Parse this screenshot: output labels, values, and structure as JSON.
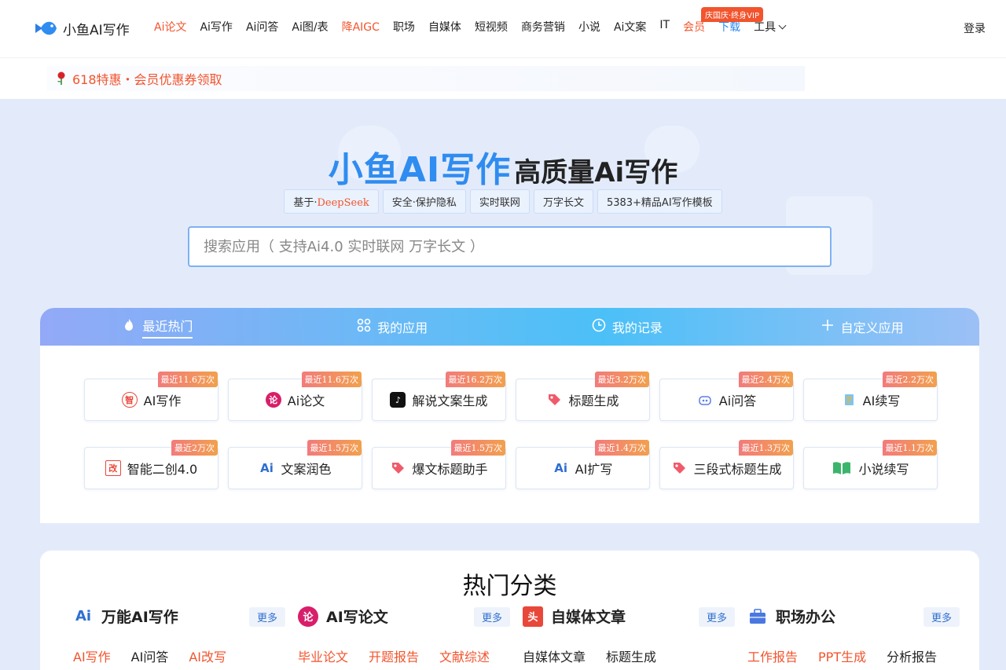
{
  "header": {
    "logo_text": "小鱼AI写作",
    "nav": [
      {
        "label": "Ai论文",
        "style": "red"
      },
      {
        "label": "Ai写作",
        "style": ""
      },
      {
        "label": "Ai问答",
        "style": ""
      },
      {
        "label": "Ai图/表",
        "style": ""
      },
      {
        "label": "降AIGC",
        "style": "red"
      },
      {
        "label": "职场",
        "style": ""
      },
      {
        "label": "自媒体",
        "style": ""
      },
      {
        "label": "短视频",
        "style": ""
      },
      {
        "label": "商务营销",
        "style": ""
      },
      {
        "label": "小说",
        "style": ""
      },
      {
        "label": "Ai文案",
        "style": ""
      },
      {
        "label": "IT",
        "style": ""
      },
      {
        "label": "会员",
        "style": "red"
      },
      {
        "label": "下载",
        "style": "blue"
      },
      {
        "label": "工具",
        "style": "dropdown"
      }
    ],
    "vip_badge": "庆国庆·终身VIP",
    "login": "登录"
  },
  "promo": {
    "icon": "rose-icon",
    "text": "618特惠・会员优惠券领取"
  },
  "hero": {
    "brand": "小鱼AI写作",
    "tagline": "高质量Ai写作",
    "chips": [
      {
        "prefix": "基于·",
        "highlight": "DeepSeek"
      },
      {
        "prefix": "安全·保护隐私",
        "highlight": ""
      },
      {
        "prefix": "实时联网",
        "highlight": ""
      },
      {
        "prefix": "万字长文",
        "highlight": ""
      },
      {
        "prefix": "5383+精品AI写作模板",
        "highlight": ""
      }
    ],
    "search_placeholder": "搜索应用（ 支持Ai4.0 实时联网 万字长文 ）"
  },
  "tabs": [
    {
      "label": "最近热门",
      "icon": "flame-icon",
      "active": true
    },
    {
      "label": "我的应用",
      "icon": "apps-grid-icon",
      "active": false
    },
    {
      "label": "我的记录",
      "icon": "clock-icon",
      "active": false
    },
    {
      "label": "自定义应用",
      "icon": "plus-icon",
      "active": false
    }
  ],
  "apps": [
    {
      "label": "AI写作",
      "hot": "最近11.6万次",
      "icon": "ai-write-icon",
      "color": "#e8483a",
      "glyph": "智"
    },
    {
      "label": "Ai论文",
      "hot": "最近11.6万次",
      "icon": "paper-icon",
      "color": "#d81e6a",
      "glyph": "论"
    },
    {
      "label": "解说文案生成",
      "hot": "最近16.2万次",
      "icon": "tiktok-icon",
      "color": "#111111",
      "glyph": "♪"
    },
    {
      "label": "标题生成",
      "hot": "最近3.2万次",
      "icon": "tag-icon",
      "color": "#f05a6a",
      "glyph": ""
    },
    {
      "label": "Ai问答",
      "hot": "最近2.4万次",
      "icon": "robot-icon",
      "color": "#5b7ee8",
      "glyph": ""
    },
    {
      "label": "AI续写",
      "hot": "最近2.2万次",
      "icon": "notebook-icon",
      "color": "#4aa8e8",
      "glyph": ""
    },
    {
      "label": "智能二创4.0",
      "hot": "最近2万次",
      "icon": "rewrite-icon",
      "color": "#e8483a",
      "glyph": "改"
    },
    {
      "label": "文案润色",
      "hot": "最近1.5万次",
      "icon": "ai-spark-icon",
      "color": "#2f6fd0",
      "glyph": "Ai"
    },
    {
      "label": "爆文标题助手",
      "hot": "最近1.5万次",
      "icon": "tag-icon",
      "color": "#f05a6a",
      "glyph": ""
    },
    {
      "label": "AI扩写",
      "hot": "最近1.4万次",
      "icon": "ai-spark-icon",
      "color": "#2f6fd0",
      "glyph": "Ai"
    },
    {
      "label": "三段式标题生成",
      "hot": "最近1.3万次",
      "icon": "tag-icon",
      "color": "#f05a6a",
      "glyph": ""
    },
    {
      "label": "小说续写",
      "hot": "最近1.1万次",
      "icon": "book-icon",
      "color": "#3bb56b",
      "glyph": ""
    }
  ],
  "categories": {
    "title": "热门分类",
    "more": "更多",
    "columns": [
      {
        "title": "万能AI写作",
        "icon": "ai-spark-icon",
        "color": "#2f6fd0",
        "glyph": "Ai",
        "links": [
          {
            "t": "AI写作",
            "red": true
          },
          {
            "t": "AI问答",
            "red": false
          },
          {
            "t": "AI改写",
            "red": true
          }
        ]
      },
      {
        "title": "AI写论文",
        "icon": "paper-icon",
        "color": "#d81e6a",
        "glyph": "论",
        "links": [
          {
            "t": "毕业论文",
            "red": true
          },
          {
            "t": "开题报告",
            "red": true
          },
          {
            "t": "文献综述",
            "red": true
          }
        ]
      },
      {
        "title": "自媒体文章",
        "icon": "social-media-icon",
        "color": "#e8483a",
        "glyph": "头",
        "links": [
          {
            "t": "自媒体文章",
            "red": false
          },
          {
            "t": "标题生成",
            "red": false
          }
        ]
      },
      {
        "title": "职场办公",
        "icon": "briefcase-icon",
        "color": "#4a78e0",
        "glyph": "",
        "links": [
          {
            "t": "工作报告",
            "red": true
          },
          {
            "t": "PPT生成",
            "red": true
          },
          {
            "t": "分析报告",
            "red": false
          }
        ]
      }
    ]
  }
}
